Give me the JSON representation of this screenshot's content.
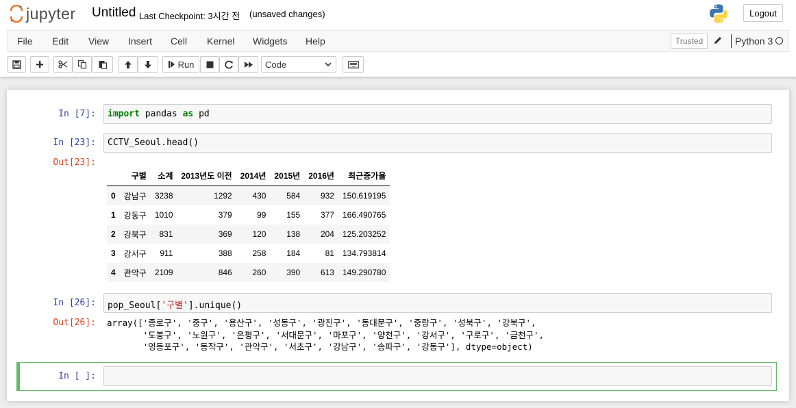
{
  "header": {
    "logo_text": "jupyter",
    "notebook_title": "Untitled",
    "checkpoint": "Last Checkpoint: 3시간 전",
    "unsaved": "(unsaved changes)",
    "logout_label": "Logout"
  },
  "menubar": {
    "items": [
      "File",
      "Edit",
      "View",
      "Insert",
      "Cell",
      "Kernel",
      "Widgets",
      "Help"
    ],
    "trusted_label": "Trusted",
    "kernel_name": "Python 3"
  },
  "toolbar": {
    "run_label": "Run",
    "cell_type": "Code"
  },
  "cells": [
    {
      "prompt": "In [7]:",
      "code_kw1": "import",
      "code_mid": " pandas ",
      "code_kw2": "as",
      "code_end": " pd"
    },
    {
      "prompt": "In [23]:",
      "code": "CCTV_Seoul.head()",
      "out_prompt": "Out[23]:"
    },
    {
      "prompt": "In [26]:",
      "code_pre": "pop_Seoul[",
      "code_str": "'구별'",
      "code_post": "].unique()",
      "out_prompt": "Out[26]:",
      "output_lines": [
        "array(['종로구', '중구', '용산구', '성동구', '광진구', '동대문구', '중랑구', '성북구', '강북구',",
        "       '도봉구', '노원구', '은평구', '서대문구', '마포구', '양천구', '강서구', '구로구', '금천구',",
        "       '영등포구', '동작구', '관악구', '서초구', '강남구', '송파구', '강동구'], dtype=object)"
      ]
    },
    {
      "prompt": "In [ ]:"
    }
  ],
  "dataframe": {
    "columns": [
      "",
      "구별",
      "소계",
      "2013년도 이전",
      "2014년",
      "2015년",
      "2016년",
      "최근증가율"
    ],
    "rows": [
      [
        "0",
        "강남구",
        "3238",
        "1292",
        "430",
        "584",
        "932",
        "150.619195"
      ],
      [
        "1",
        "강동구",
        "1010",
        "379",
        "99",
        "155",
        "377",
        "166.490765"
      ],
      [
        "2",
        "강북구",
        "831",
        "369",
        "120",
        "138",
        "204",
        "125.203252"
      ],
      [
        "3",
        "강서구",
        "911",
        "388",
        "258",
        "184",
        "81",
        "134.793814"
      ],
      [
        "4",
        "관악구",
        "2109",
        "846",
        "260",
        "390",
        "613",
        "149.290780"
      ]
    ]
  }
}
